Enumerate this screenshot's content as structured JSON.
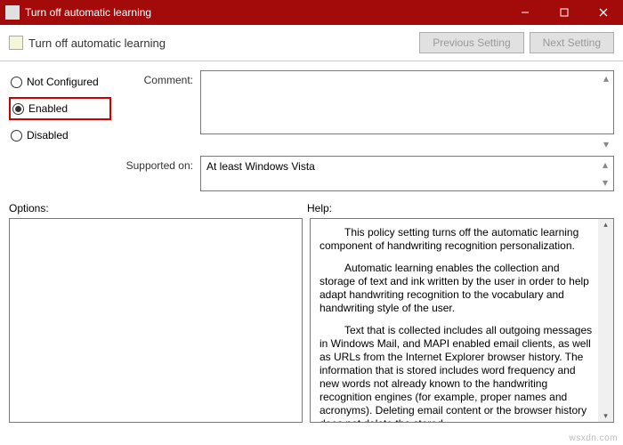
{
  "window": {
    "title": "Turn off automatic learning"
  },
  "header": {
    "title": "Turn off automatic learning",
    "prev": "Previous Setting",
    "next": "Next Setting"
  },
  "radios": {
    "not_configured": "Not Configured",
    "enabled": "Enabled",
    "disabled": "Disabled"
  },
  "labels": {
    "comment": "Comment:",
    "supported": "Supported on:",
    "options": "Options:",
    "help": "Help:"
  },
  "supported_value": "At least Windows Vista",
  "help": {
    "p1": "This policy setting turns off the automatic learning component of handwriting recognition personalization.",
    "p2": "Automatic learning enables the collection and storage of text and ink written by the user in order to help adapt handwriting recognition to the vocabulary and handwriting style of the user.",
    "p3": "Text that is collected includes all outgoing messages in Windows Mail, and MAPI enabled email clients, as well as URLs from the Internet Explorer browser history. The information that is stored includes word frequency and new words not already known to the handwriting recognition engines (for example, proper names and acronyms). Deleting email content or the browser history does not delete the stored"
  },
  "watermark": "wsxdn.com"
}
